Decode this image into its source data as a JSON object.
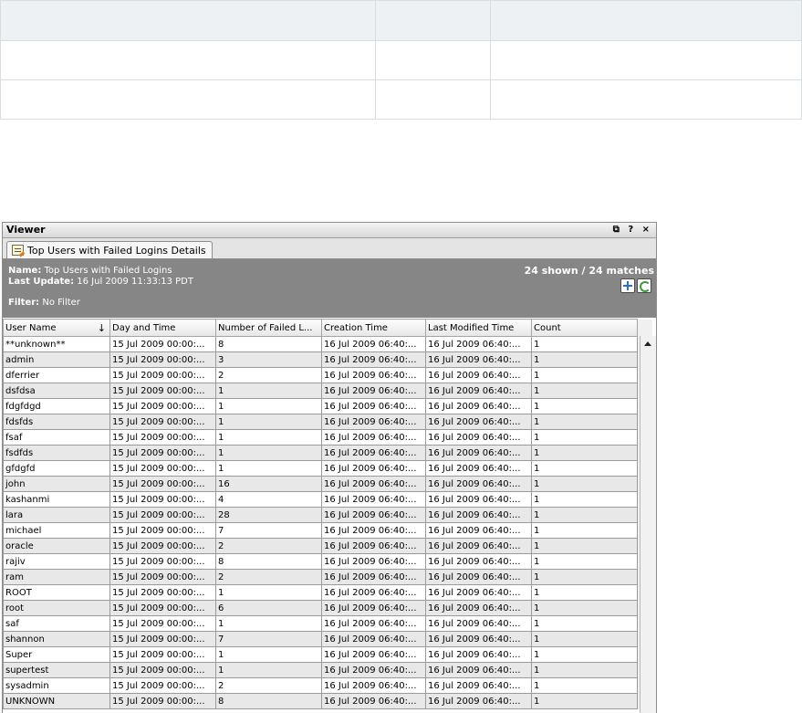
{
  "viewer": {
    "title": "Viewer",
    "controls": "⧉ ? ×",
    "tab_label": "Top Users with Failed Logins Details",
    "info": {
      "name_label": "Name:",
      "name_value": "Top Users with Failed Logins",
      "update_label": "Last Update:",
      "update_value": "16 Jul 2009 11:33:13 PDT",
      "filter_label": "Filter:",
      "filter_value": "No Filter",
      "count_text": "24 shown / 24 matches"
    },
    "columns": [
      "User Name",
      "Day and Time",
      "Number of Failed L...",
      "Creation Time",
      "Last Modified Time",
      "Count"
    ],
    "rows": [
      [
        "**unknown**",
        "15 Jul 2009 00:00:...",
        "8",
        "16 Jul 2009 06:40:...",
        "16 Jul 2009 06:40:...",
        "1"
      ],
      [
        "admin",
        "15 Jul 2009 00:00:...",
        "3",
        "16 Jul 2009 06:40:...",
        "16 Jul 2009 06:40:...",
        "1"
      ],
      [
        "dferrier",
        "15 Jul 2009 00:00:...",
        "2",
        "16 Jul 2009 06:40:...",
        "16 Jul 2009 06:40:...",
        "1"
      ],
      [
        "dsfdsa",
        "15 Jul 2009 00:00:...",
        "1",
        "16 Jul 2009 06:40:...",
        "16 Jul 2009 06:40:...",
        "1"
      ],
      [
        "fdgfdgd",
        "15 Jul 2009 00:00:...",
        "1",
        "16 Jul 2009 06:40:...",
        "16 Jul 2009 06:40:...",
        "1"
      ],
      [
        "fdsfds",
        "15 Jul 2009 00:00:...",
        "1",
        "16 Jul 2009 06:40:...",
        "16 Jul 2009 06:40:...",
        "1"
      ],
      [
        "fsaf",
        "15 Jul 2009 00:00:...",
        "1",
        "16 Jul 2009 06:40:...",
        "16 Jul 2009 06:40:...",
        "1"
      ],
      [
        "fsdfds",
        "15 Jul 2009 00:00:...",
        "1",
        "16 Jul 2009 06:40:...",
        "16 Jul 2009 06:40:...",
        "1"
      ],
      [
        "gfdgfd",
        "15 Jul 2009 00:00:...",
        "1",
        "16 Jul 2009 06:40:...",
        "16 Jul 2009 06:40:...",
        "1"
      ],
      [
        "john",
        "15 Jul 2009 00:00:...",
        "16",
        "16 Jul 2009 06:40:...",
        "16 Jul 2009 06:40:...",
        "1"
      ],
      [
        "kashanmi",
        "15 Jul 2009 00:00:...",
        "4",
        "16 Jul 2009 06:40:...",
        "16 Jul 2009 06:40:...",
        "1"
      ],
      [
        "lara",
        "15 Jul 2009 00:00:...",
        "28",
        "16 Jul 2009 06:40:...",
        "16 Jul 2009 06:40:...",
        "1"
      ],
      [
        "michael",
        "15 Jul 2009 00:00:...",
        "7",
        "16 Jul 2009 06:40:...",
        "16 Jul 2009 06:40:...",
        "1"
      ],
      [
        "oracle",
        "15 Jul 2009 00:00:...",
        "2",
        "16 Jul 2009 06:40:...",
        "16 Jul 2009 06:40:...",
        "1"
      ],
      [
        "rajiv",
        "15 Jul 2009 00:00:...",
        "8",
        "16 Jul 2009 06:40:...",
        "16 Jul 2009 06:40:...",
        "1"
      ],
      [
        "ram",
        "15 Jul 2009 00:00:...",
        "2",
        "16 Jul 2009 06:40:...",
        "16 Jul 2009 06:40:...",
        "1"
      ],
      [
        "ROOT",
        "15 Jul 2009 00:00:...",
        "1",
        "16 Jul 2009 06:40:...",
        "16 Jul 2009 06:40:...",
        "1"
      ],
      [
        "root",
        "15 Jul 2009 00:00:...",
        "6",
        "16 Jul 2009 06:40:...",
        "16 Jul 2009 06:40:...",
        "1"
      ],
      [
        "saf",
        "15 Jul 2009 00:00:...",
        "1",
        "16 Jul 2009 06:40:...",
        "16 Jul 2009 06:40:...",
        "1"
      ],
      [
        "shannon",
        "15 Jul 2009 00:00:...",
        "7",
        "16 Jul 2009 06:40:...",
        "16 Jul 2009 06:40:...",
        "1"
      ],
      [
        "Super",
        "15 Jul 2009 00:00:...",
        "1",
        "16 Jul 2009 06:40:...",
        "16 Jul 2009 06:40:...",
        "1"
      ],
      [
        "supertest",
        "15 Jul 2009 00:00:...",
        "1",
        "16 Jul 2009 06:40:...",
        "16 Jul 2009 06:40:...",
        "1"
      ],
      [
        "sysadmin",
        "15 Jul 2009 00:00:...",
        "2",
        "16 Jul 2009 06:40:...",
        "16 Jul 2009 06:40:...",
        "1"
      ],
      [
        "UNKNOWN",
        "15 Jul 2009 00:00:...",
        "8",
        "16 Jul 2009 06:40:...",
        "16 Jul 2009 06:40:...",
        "1"
      ]
    ],
    "icons": {
      "tab": "report-icon",
      "add": "add-icon",
      "refresh": "refresh-icon",
      "sort": "sort-descending-icon"
    }
  }
}
